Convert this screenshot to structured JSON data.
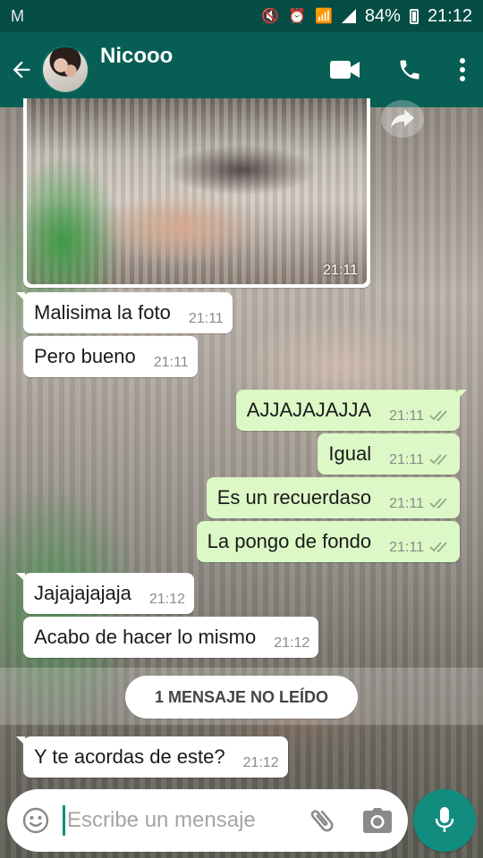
{
  "status_bar": {
    "battery": "84%",
    "time": "21:12"
  },
  "header": {
    "contact_name": "Nicooo"
  },
  "image_message": {
    "time": "21:11"
  },
  "messages": [
    {
      "direction": "in",
      "text": "Malisima la foto",
      "time": "21:11"
    },
    {
      "direction": "in",
      "text": "Pero bueno",
      "time": "21:11"
    },
    {
      "direction": "out",
      "text": "AJJAJAJAJJA",
      "time": "21:11",
      "status": "read"
    },
    {
      "direction": "out",
      "text": "Igual",
      "time": "21:11",
      "status": "read"
    },
    {
      "direction": "out",
      "text": "Es un recuerdaso",
      "time": "21:11",
      "status": "read"
    },
    {
      "direction": "out",
      "text": "La pongo de fondo",
      "time": "21:11",
      "status": "read"
    },
    {
      "direction": "in",
      "text": "Jajajajajaja",
      "time": "21:12"
    },
    {
      "direction": "in",
      "text": "Acabo de hacer lo mismo",
      "time": "21:12"
    },
    {
      "direction": "in",
      "text": "Y te acordas de este?",
      "time": "21:12"
    }
  ],
  "unread_divider": "1 MENSAJE NO LEÍDO",
  "composer": {
    "placeholder": "Escribe un mensaje"
  },
  "colors": {
    "header": "#075e54",
    "status_bar": "#054d44",
    "outgoing_bubble": "#dcf8c6",
    "incoming_bubble": "#ffffff",
    "accent": "#128c7e",
    "read_ticks": "#8fa88a"
  },
  "icons": {
    "back": "arrow-left-icon",
    "video": "video-camera-icon",
    "call": "phone-icon",
    "menu": "more-vertical-icon",
    "forward": "forward-arrow-icon",
    "emoji": "smiley-icon",
    "attach": "paperclip-icon",
    "camera": "camera-icon",
    "mic": "microphone-icon",
    "read": "double-check-icon"
  }
}
